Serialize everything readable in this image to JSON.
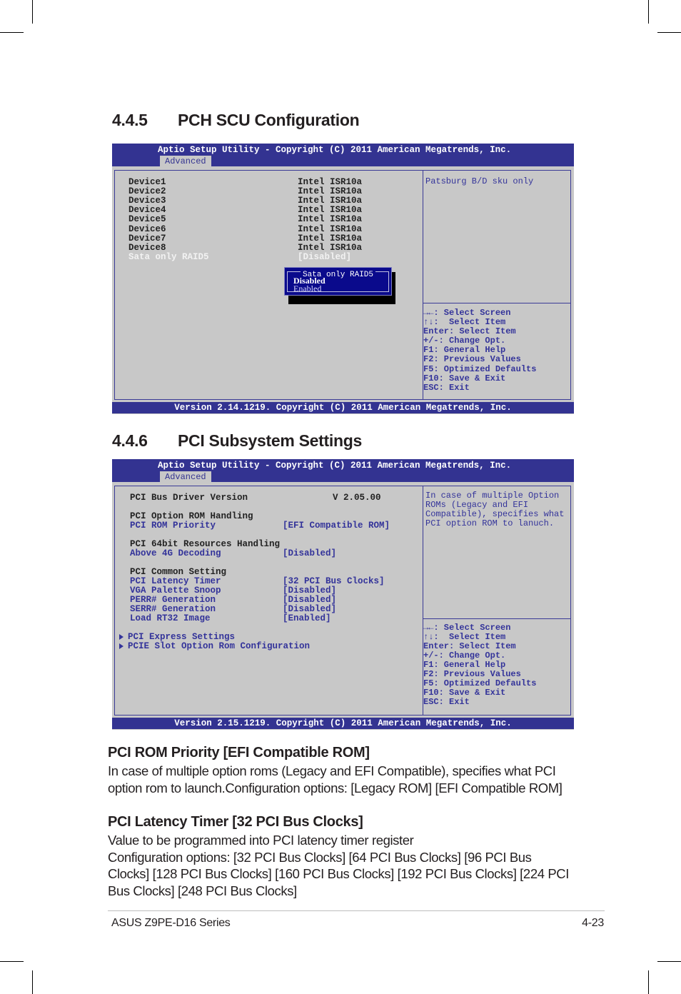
{
  "sections": [
    {
      "number": "4.4.5",
      "title": "PCH SCU Configuration",
      "bios": {
        "title": "Aptio Setup Utility - Copyright (C) 2011 American Megatrends, Inc.",
        "tab": "Advanced",
        "version": "Version 2.14.1219. Copyright (C) 2011 American Megatrends, Inc.",
        "items": [
          {
            "label": "Device1",
            "value": "Intel ISR10a"
          },
          {
            "label": "Device2",
            "value": "Intel ISR10a"
          },
          {
            "label": "Device3",
            "value": "Intel ISR10a"
          },
          {
            "label": "Device4",
            "value": "Intel ISR10a"
          },
          {
            "label": "Device5",
            "value": "Intel ISR10a"
          },
          {
            "label": "Device6",
            "value": "Intel ISR10a"
          },
          {
            "label": "Device7",
            "value": "Intel ISR10a"
          },
          {
            "label": "Device8",
            "value": "Intel ISR10a"
          },
          {
            "label": "Sata only RAID5",
            "value": "[Disabled]",
            "selected": true
          }
        ],
        "popup": {
          "title": "Sata only RAID5",
          "options": [
            "Disabled",
            "Enabled"
          ],
          "selected": "Disabled"
        },
        "help_text": "Patsburg B/D sku only",
        "keys": [
          "→←: Select Screen",
          "↑↓:  Select Item",
          "Enter: Select Item",
          "+/-: Change Opt.",
          "F1: General Help",
          "F2: Previous Values",
          "F5: Optimized Defaults",
          "F10: Save & Exit",
          "ESC: Exit"
        ]
      }
    },
    {
      "number": "4.4.6",
      "title": "PCI Subsystem Settings",
      "bios": {
        "title": "Aptio Setup Utility - Copyright (C) 2011 American Megatrends, Inc.",
        "tab": "Advanced",
        "version": "Version 2.15.1219. Copyright (C) 2011 American Megatrends, Inc.",
        "driver_label": "PCI Bus Driver Version",
        "driver_value": "V 2.05.00",
        "groups": [
          {
            "heading": "PCI Option ROM Handling",
            "items": [
              {
                "label": "PCI ROM Priority",
                "value": "[EFI Compatible ROM]"
              }
            ]
          },
          {
            "heading": "PCI 64bit Resources Handling",
            "items": [
              {
                "label": "Above 4G Decoding",
                "value": "[Disabled]"
              }
            ]
          },
          {
            "heading": "PCI Common Setting",
            "items": [
              {
                "label": "PCI Latency Timer",
                "value": "[32 PCI Bus Clocks]"
              },
              {
                "label": "VGA Palette Snoop",
                "value": "[Disabled]"
              },
              {
                "label": "PERR# Generation",
                "value": "[Disabled]"
              },
              {
                "label": "SERR# Generation",
                "value": "[Disabled]"
              },
              {
                "label": "Load RT32 Image",
                "value": "[Enabled]"
              }
            ]
          }
        ],
        "submenus": [
          "PCI Express Settings",
          "PCIE Slot Option Rom Configuration"
        ],
        "help_lines": [
          "In case of multiple Option",
          "ROMs (Legacy and EFI",
          "Compatible), specifies what",
          "PCI option ROM to lanuch."
        ],
        "keys": [
          "→←: Select Screen",
          "↑↓:  Select Item",
          "Enter: Select Item",
          "+/-: Change Opt.",
          "F1: General Help",
          "F2: Previous Values",
          "F5: Optimized Defaults",
          "F10: Save & Exit",
          "ESC: Exit"
        ]
      }
    }
  ],
  "descriptions": [
    {
      "heading": "PCI ROM Priority [EFI Compatible ROM]",
      "lines": [
        "In case of multiple option roms (Legacy and EFI Compatible), specifies what PCI",
        "option rom to launch.Configuration options: [Legacy ROM] [EFI Compatible ROM]"
      ]
    },
    {
      "heading": "PCI Latency Timer [32 PCI Bus Clocks]",
      "lines": [
        "Value to be programmed into PCI latency timer register",
        "Configuration options: [32 PCI Bus Clocks] [64 PCI Bus Clocks] [96 PCI Bus",
        "Clocks] [128 PCI Bus Clocks] [160 PCI Bus Clocks] [192 PCI Bus Clocks] [224 PCI",
        "Bus Clocks] [248 PCI Bus Clocks]"
      ]
    }
  ],
  "footer": {
    "product": "ASUS Z9PE-D16 Series",
    "page": "4-23"
  }
}
